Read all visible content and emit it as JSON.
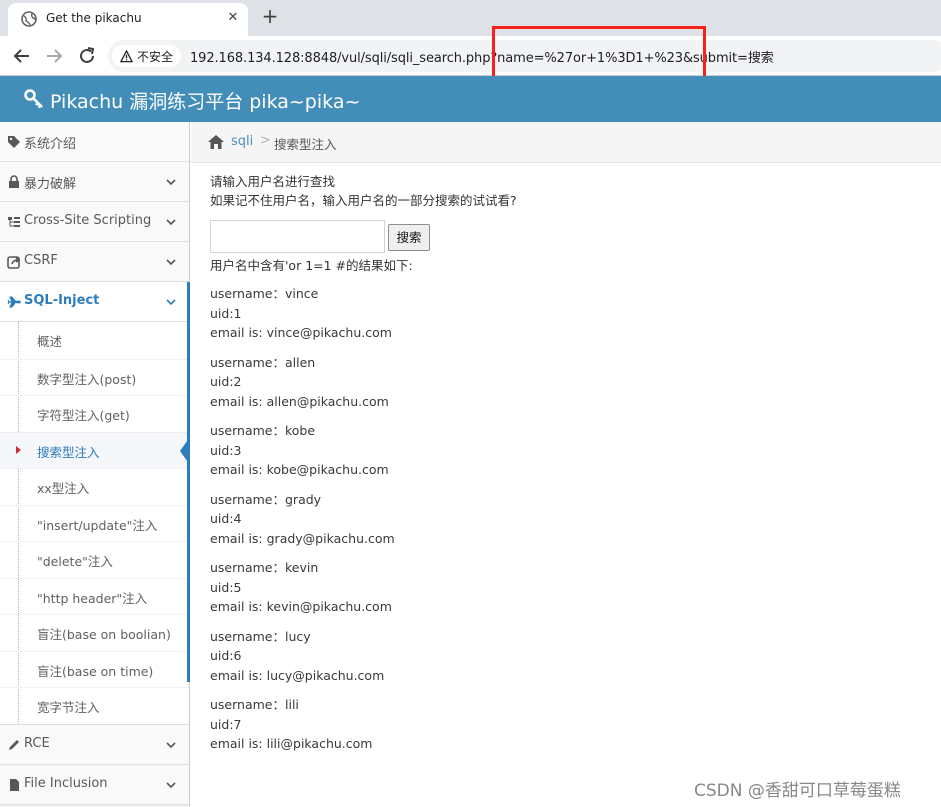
{
  "browser": {
    "tab_title": "Get the pikachu",
    "tab_close": "✕",
    "new_tab": "+",
    "security_label": "不安全",
    "url": "192.168.134.128:8848/vul/sqli/sqli_search.php?name=%27or+1%3D1+%23&submit=搜索",
    "highlight_color": "#f5221c"
  },
  "header": {
    "title": "Pikachu 漏洞练习平台 pika~pika~",
    "background": "#438eb9"
  },
  "sidebar": {
    "items_top": [
      {
        "label": "系统介绍",
        "icon": "tags-icon",
        "chevron": false
      },
      {
        "label": "暴力破解",
        "icon": "lock-icon",
        "chevron": true
      },
      {
        "label": "Cross-Site Scripting",
        "icon": "sitemap-icon",
        "chevron": true
      },
      {
        "label": "CSRF",
        "icon": "share-icon",
        "chevron": true
      },
      {
        "label": "SQL-Inject",
        "icon": "plane-icon",
        "chevron": true
      }
    ],
    "sql_submenu": [
      {
        "label": "概述"
      },
      {
        "label": "数字型注入(post)"
      },
      {
        "label": "字符型注入(get)"
      },
      {
        "label": "搜索型注入"
      },
      {
        "label": "xx型注入"
      },
      {
        "label": "\"insert/update\"注入"
      },
      {
        "label": "\"delete\"注入"
      },
      {
        "label": "\"http header\"注入"
      },
      {
        "label": "盲注(base on boolian)"
      },
      {
        "label": "盲注(base on time)"
      },
      {
        "label": "宽字节注入"
      }
    ],
    "items_bottom": [
      {
        "label": "RCE",
        "icon": "pencil-icon"
      },
      {
        "label": "File Inclusion",
        "icon": "file-icon"
      }
    ],
    "accent": "#2b7dbc"
  },
  "breadcrumb": {
    "link": "sqli",
    "separator": ">",
    "current": "搜索型注入"
  },
  "main": {
    "intro_line1": "请输入用户名进行查找",
    "intro_line2": "如果记不住用户名，输入用户名的一部分搜索的试试看?",
    "search_value": "",
    "search_button": "搜索",
    "result_header": "用户名中含有'or 1=1 #的结果如下:",
    "results": [
      {
        "username": "username：vince",
        "uid": "uid:1",
        "email": "email is: vince@pikachu.com"
      },
      {
        "username": "username：allen",
        "uid": "uid:2",
        "email": "email is: allen@pikachu.com"
      },
      {
        "username": "username：kobe",
        "uid": "uid:3",
        "email": "email is: kobe@pikachu.com"
      },
      {
        "username": "username：grady",
        "uid": "uid:4",
        "email": "email is: grady@pikachu.com"
      },
      {
        "username": "username：kevin",
        "uid": "uid:5",
        "email": "email is: kevin@pikachu.com"
      },
      {
        "username": "username：lucy",
        "uid": "uid:6",
        "email": "email is: lucy@pikachu.com"
      },
      {
        "username": "username：lili",
        "uid": "uid:7",
        "email": "email is: lili@pikachu.com"
      }
    ]
  },
  "watermark": "CSDN @香甜可口草莓蛋糕"
}
